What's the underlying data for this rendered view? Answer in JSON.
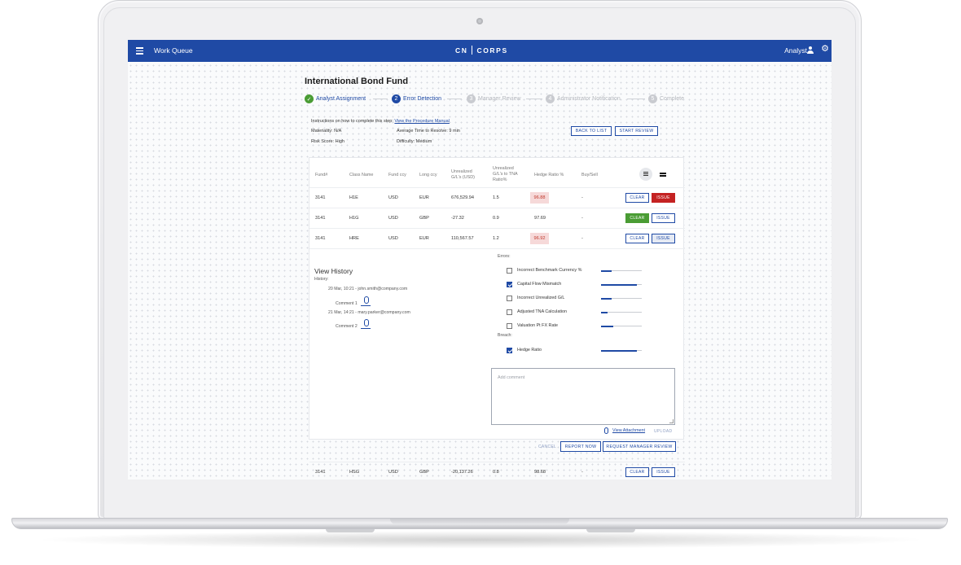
{
  "appbar": {
    "title": "Work Queue",
    "logo_left": "CN",
    "logo_right": "CORPS",
    "user_label": "Analyst",
    "brand_color": "#1f4aa5"
  },
  "fund": {
    "title": "International Bond Fund"
  },
  "stepper": {
    "steps": [
      {
        "number": "1",
        "label": "Analyst Assignment",
        "state": "done"
      },
      {
        "number": "2",
        "label": "Error Detection",
        "state": "active"
      },
      {
        "number": "3",
        "label": "Manager Review",
        "state": "todo"
      },
      {
        "number": "4",
        "label": "Administrator Notification",
        "state": "todo"
      },
      {
        "number": "5",
        "label": "Complete",
        "state": "todo"
      }
    ]
  },
  "info": {
    "instructions": "Instructions on how to complete this step:",
    "manual_link": "View the Procedure Manual",
    "materiality": "Materiality: N/A",
    "avg_time": "Average Time to Resolve: 9 min",
    "risk_score": "Risk Score: High",
    "difficulty": "Difficulty: Medium",
    "back_button": "BACK TO LIST",
    "start_button": "START REVIEW"
  },
  "table": {
    "headers": {
      "fund": "Fund#",
      "class_name": "Class Name",
      "fund_ccy": "Fund ccy",
      "long_ccy": "Long ccy",
      "unrealized_1": "Unrealized",
      "unrealized_2": "G/L's (USD)",
      "ratio_1": "Unrealized",
      "ratio_2": "G/L's to TNA",
      "ratio_3": "Ratio%",
      "hedge": "Hedge Ratio %",
      "buysell": "Buy/Sell"
    },
    "rows": [
      {
        "fund": "3141",
        "class_name": "H1E",
        "fund_ccy": "USD",
        "long_ccy": "EUR",
        "unrealized": "676,529.94",
        "ratio": "1.5",
        "hedge": "96.88",
        "buysell": "-",
        "clear": "CLEAR",
        "issue": "ISSUE"
      },
      {
        "fund": "3141",
        "class_name": "H1G",
        "fund_ccy": "USD",
        "long_ccy": "GBP",
        "unrealized": "-27.32",
        "ratio": "0.9",
        "hedge": "97.69",
        "buysell": "-",
        "clear": "CLEAR",
        "issue": "ISSUE"
      },
      {
        "fund": "3141",
        "class_name": "HRE",
        "fund_ccy": "USD",
        "long_ccy": "EUR",
        "unrealized": "110,567.57",
        "ratio": "1.2",
        "hedge": "96.92",
        "buysell": "-",
        "clear": "CLEAR",
        "issue": "ISSUE"
      },
      {
        "fund": "3141",
        "class_name": "HSG",
        "fund_ccy": "USD",
        "long_ccy": "GBP",
        "unrealized": "-20,137.26",
        "ratio": "0.8",
        "hedge": "98.68",
        "buysell": "-",
        "clear": "CLEAR",
        "issue": "ISSUE"
      }
    ]
  },
  "history": {
    "title": "View History",
    "label": "History:",
    "entries": [
      {
        "meta": "20 Mar, 10:21 - john.smith@company.com",
        "comment": "Comment 1"
      },
      {
        "meta": "21 Mar, 14:21 - mary.parker@company.com",
        "comment": "Comment 2"
      }
    ]
  },
  "errors": {
    "label": "Errors:",
    "items": [
      {
        "label": "Incorrect Benchmark Currency %",
        "checked": false,
        "level": 0.25
      },
      {
        "label": "Capital Flow Mismatch",
        "checked": true,
        "level": 0.88
      },
      {
        "label": "Incorrect Unrealized G/L",
        "checked": false,
        "level": 0.25
      },
      {
        "label": "Adjusted TNA Calculation",
        "checked": false,
        "level": 0.15
      },
      {
        "label": "Valuation Pt FX Rate",
        "checked": false,
        "level": 0.3
      }
    ],
    "breach_label": "Breach:",
    "breach_items": [
      {
        "label": "Hedge Ratio",
        "checked": true,
        "level": 0.88
      }
    ]
  },
  "comment": {
    "placeholder": "Add comment",
    "attachment_link": "View Attachment",
    "upload": "UPLOAD",
    "cancel": "CANCEL",
    "report_now": "REPORT NOW",
    "request_review": "REQUEST MANAGER REVIEW"
  }
}
